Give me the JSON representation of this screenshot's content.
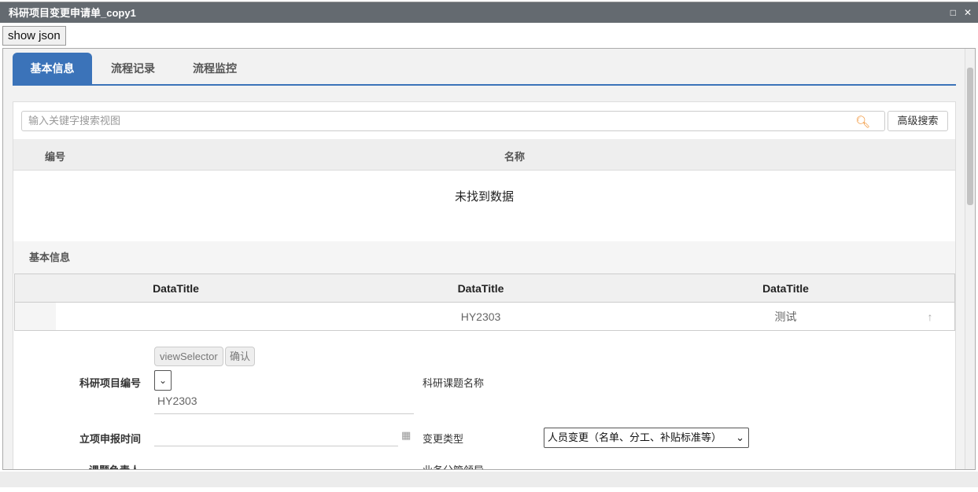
{
  "window": {
    "title": "科研项目变更申请单_copy1",
    "maximize_icon": "□",
    "close_icon": "✕"
  },
  "toolbar": {
    "show_json": "show json"
  },
  "tabs": [
    {
      "label": "基本信息"
    },
    {
      "label": "流程记录"
    },
    {
      "label": "流程监控"
    }
  ],
  "search": {
    "placeholder": "输入关键字搜索视图",
    "advanced": "高级搜索"
  },
  "table": {
    "columns": [
      "编号",
      "名称"
    ],
    "empty": "未找到数据"
  },
  "section": {
    "title": "基本信息"
  },
  "grid": {
    "columns": [
      "DataTitle",
      "DataTitle",
      "DataTitle"
    ],
    "row": [
      "",
      "HY2303",
      "测试"
    ],
    "sort_icon": "↑"
  },
  "form": {
    "view_selector": "viewSelector",
    "confirm": "确认",
    "project_no_label": "科研项目编号",
    "project_no_value": "HY2303",
    "topic_name_label": "科研课题名称",
    "report_time_label": "立项申报时间",
    "change_type_label": "变更类型",
    "change_type_value": "人员变更（名单、分工、补贴标准等）",
    "leader_label": "课题负责人",
    "manager_label": "业务分管领导"
  }
}
